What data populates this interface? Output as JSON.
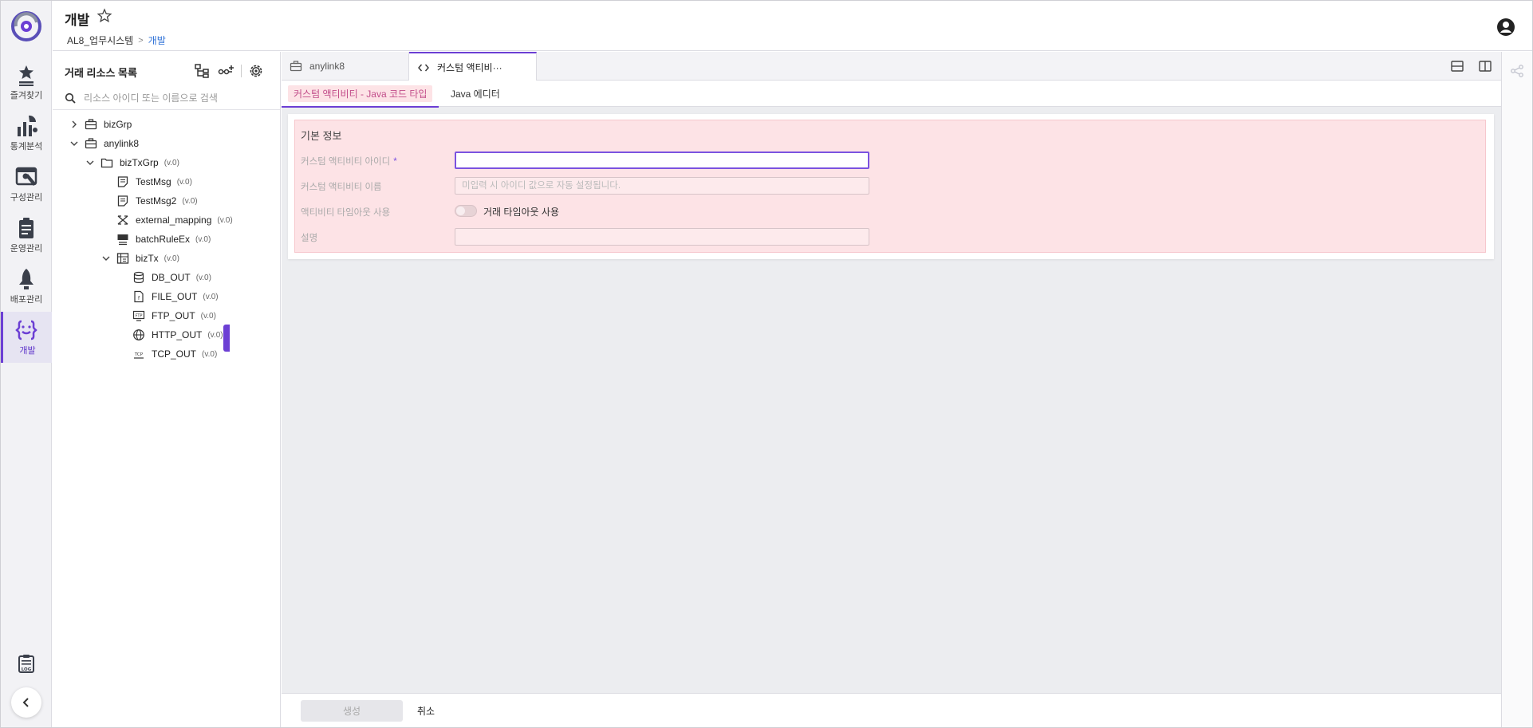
{
  "header": {
    "title": "개발",
    "breadcrumb": [
      "AL8_업무시스템",
      "개발"
    ]
  },
  "rail": {
    "items": [
      {
        "label": "즐겨찾기",
        "icon": "star-list-icon"
      },
      {
        "label": "통계분석",
        "icon": "chart-icon"
      },
      {
        "label": "구성관리",
        "icon": "config-tools-icon"
      },
      {
        "label": "운영관리",
        "icon": "clipboard-icon"
      },
      {
        "label": "배포관리",
        "icon": "rocket-icon"
      },
      {
        "label": "개발",
        "icon": "code-braces-icon"
      }
    ],
    "active": "개발",
    "log_icon": "log-icon",
    "collapse_icon": "chevron-left-icon"
  },
  "resources": {
    "title": "거래 리소스 목록",
    "search_placeholder": "리소스 아이디 또는 이름으로 검색",
    "tree": [
      {
        "label": "bizGrp",
        "version": "",
        "icon": "briefcase-icon",
        "expanded": false
      },
      {
        "label": "anylink8",
        "version": "",
        "icon": "briefcase-icon",
        "expanded": true
      },
      {
        "label": "bizTxGrp",
        "version": "(v.0)",
        "icon": "folder-icon",
        "expanded": true
      },
      {
        "label": "TestMsg",
        "version": "(v.0)",
        "icon": "message-icon"
      },
      {
        "label": "TestMsg2",
        "version": "(v.0)",
        "icon": "message-icon"
      },
      {
        "label": "external_mapping",
        "version": "(v.0)",
        "icon": "mapping-icon"
      },
      {
        "label": "batchRuleEx",
        "version": "(v.0)",
        "icon": "batch-icon"
      },
      {
        "label": "bizTx",
        "version": "(v.0)",
        "icon": "transaction-icon",
        "expanded": true
      },
      {
        "label": "DB_OUT",
        "version": "(v.0)",
        "icon": "database-icon"
      },
      {
        "label": "FILE_OUT",
        "version": "(v.0)",
        "icon": "file-icon"
      },
      {
        "label": "FTP_OUT",
        "version": "(v.0)",
        "icon": "ftp-icon"
      },
      {
        "label": "HTTP_OUT",
        "version": "(v.0)",
        "icon": "globe-icon"
      },
      {
        "label": "TCP_OUT",
        "version": "(v.0)",
        "icon": "tcp-icon"
      }
    ]
  },
  "tabs": [
    {
      "label": "anylink8",
      "icon": "briefcase-icon",
      "active": false
    },
    {
      "label": "커스텀 액티비···",
      "icon": "code-icon",
      "active": true
    }
  ],
  "subtabs": [
    {
      "label": "커스텀 액티비티 - Java 코드 타입",
      "active": true
    },
    {
      "label": "Java 에디터",
      "active": false
    }
  ],
  "form": {
    "section_title": "기본 정보",
    "id_label": "커스텀 액티비티 아이디",
    "id_required": "*",
    "id_value": "",
    "name_label": "커스텀 액티비티 이름",
    "name_placeholder": "미입력 시 아이디 값으로 자동 설정됩니다.",
    "timeout_label": "액티비티 타임아웃 사용",
    "timeout_toggle_label": "거래 타임아웃 사용",
    "timeout_on": false,
    "desc_label": "설명",
    "desc_value": ""
  },
  "footer": {
    "create_label": "생성",
    "cancel_label": "취소"
  },
  "colors": {
    "accent": "#6c3fd4",
    "form_bg": "#fde3e6",
    "breadcrumb_current": "#2b6fd6"
  }
}
